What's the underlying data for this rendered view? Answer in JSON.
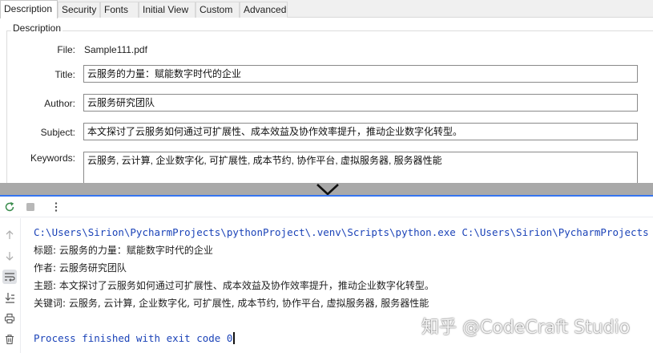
{
  "dialog": {
    "tabs": [
      {
        "label": "Description",
        "active": true
      },
      {
        "label": "Security",
        "active": false
      },
      {
        "label": "Fonts",
        "active": false
      },
      {
        "label": "Initial View",
        "active": false
      },
      {
        "label": "Custom",
        "active": false
      },
      {
        "label": "Advanced",
        "active": false
      }
    ],
    "group_title": "Description",
    "fields": {
      "file_label": "File:",
      "file_value": "Sample111.pdf",
      "title_label": "Title:",
      "title_value": "云服务的力量：赋能数字时代的企业",
      "author_label": "Author:",
      "author_value": "云服务研究团队",
      "subject_label": "Subject:",
      "subject_value": "本文探讨了云服务如何通过可扩展性、成本效益及协作效率提升，推动企业数字化转型。",
      "keywords_label": "Keywords:",
      "keywords_value": "云服务, 云计算, 企业数字化, 可扩展性, 成本节约, 协作平台, 虚拟服务器, 服务器性能"
    }
  },
  "console": {
    "toolbar_icons": [
      "rerun-icon",
      "stop-icon",
      "more-options-icon"
    ],
    "gutter_icons": [
      "scroll-up-icon",
      "scroll-down-icon",
      "soft-wrap-icon",
      "scroll-to-end-icon",
      "print-icon",
      "clear-icon"
    ],
    "command": "C:\\Users\\Sirion\\PycharmProjects\\pythonProject\\.venv\\Scripts\\python.exe C:\\Users\\Sirion\\PycharmProjects",
    "lines": [
      "标题: 云服务的力量：赋能数字时代的企业",
      "作者: 云服务研究团队",
      "主题: 本文探讨了云服务如何通过可扩展性、成本效益及协作效率提升，推动企业数字化转型。",
      "关键词: 云服务, 云计算, 企业数字化, 可扩展性, 成本节约, 协作平台, 虚拟服务器, 服务器性能"
    ],
    "finished": "Process finished with exit code 0"
  },
  "watermark": "知乎 @CodeCraft Studio",
  "colors": {
    "accent_blue": "#3574f0",
    "console_blue": "#1b43b8",
    "divider_gray": "#a9a9a9"
  }
}
